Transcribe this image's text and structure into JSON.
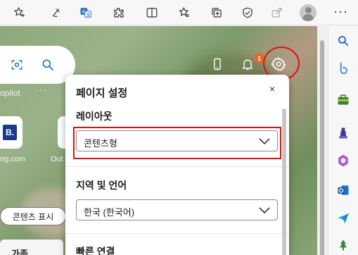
{
  "toolbar": {
    "icons": [
      "add-favorite-icon",
      "read-aloud-icon",
      "translate-icon",
      "extensions-icon",
      "split-screen-icon",
      "favorites-icon",
      "collections-icon",
      "browser-essentials-icon",
      "share-icon",
      "profile-avatar",
      "more-menu-icon"
    ],
    "more_label": "···"
  },
  "page": {
    "copilot_text": "opilot",
    "dots": "···",
    "tiles": [
      {
        "label": "ng.com",
        "icon_text": "B."
      },
      {
        "label": "Out",
        "icon_text": ""
      }
    ],
    "content_button": "콘텐츠 표시",
    "bottom_card_text": "가족",
    "notification_count": "1"
  },
  "panel": {
    "title": "페이지 설정",
    "close": "×",
    "layout_label": "레이아웃",
    "layout_value": "콘텐츠형",
    "region_label": "지역 및 언어",
    "region_value": "한국 (한국어)",
    "quick_links_label": "빠른 연결"
  },
  "colors": {
    "highlight": "#e01010",
    "accent": "#1a73c8",
    "badge": "#e06a2a"
  }
}
